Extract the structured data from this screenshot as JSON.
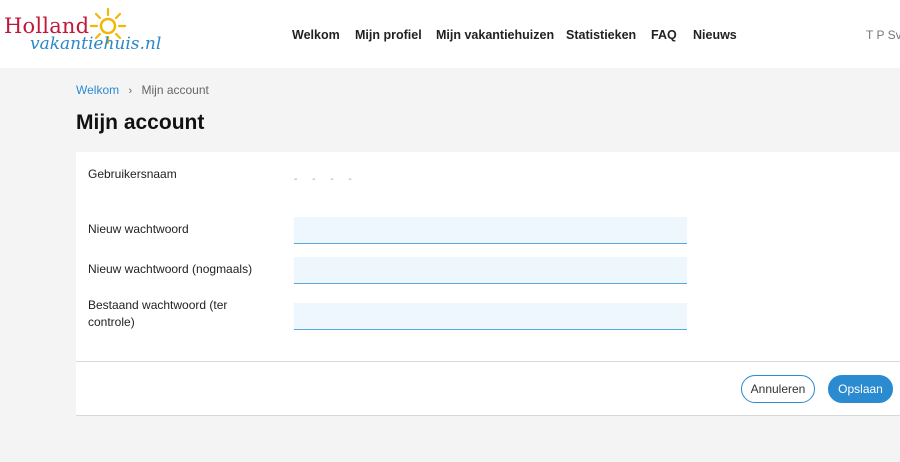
{
  "brand": {
    "logo_line1": "Holland",
    "logo_line2": "vakantiehuis.nl",
    "colors": {
      "red": "#c0183a",
      "blue": "#2b88c8",
      "sun": "#f2b705"
    }
  },
  "nav": {
    "items": [
      {
        "label": "Welkom"
      },
      {
        "label": "Mijn profiel"
      },
      {
        "label": "Mijn vakantiehuizen"
      },
      {
        "label": "Statistieken"
      },
      {
        "label": "FAQ"
      },
      {
        "label": "Nieuws"
      }
    ],
    "user": "T P Sv"
  },
  "breadcrumb": {
    "home": "Welkom",
    "separator": "›",
    "current": "Mijn account"
  },
  "page": {
    "title": "Mijn account"
  },
  "form": {
    "username_label": "Gebruikersnaam",
    "username_value": "- - - -",
    "new_password_label": "Nieuw wachtwoord",
    "new_password_value": "",
    "repeat_password_label": "Nieuw wachtwoord (nogmaals)",
    "repeat_password_value": "",
    "current_password_label": "Bestaand wachtwoord (ter controle)",
    "current_password_value": "",
    "cancel_label": "Annuleren",
    "save_label": "Opslaan"
  },
  "colors": {
    "accent": "#2a8bd0",
    "input_bg": "#eef7fd",
    "page_bg": "#f4f4f4"
  }
}
